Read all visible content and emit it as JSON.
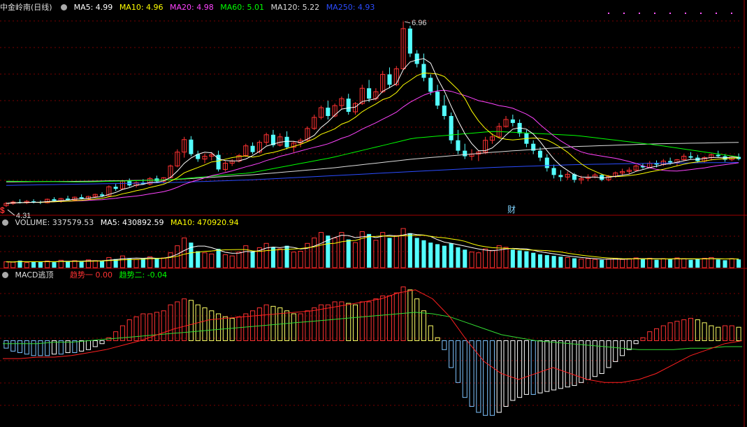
{
  "header": {
    "stock_name": "中金岭南(日线)",
    "ma": [
      {
        "label": "MA5: 4.99",
        "color": "#ffffff"
      },
      {
        "label": "MA10: 4.96",
        "color": "#ffff00"
      },
      {
        "label": "MA20: 4.98",
        "color": "#ff44ff"
      },
      {
        "label": "MA60: 5.01",
        "color": "#00ff00"
      },
      {
        "label": "MA120: 5.22",
        "color": "#dddddd"
      },
      {
        "label": "MA250: 4.93",
        "color": "#2b4cff"
      }
    ]
  },
  "annotations": {
    "high": "6.96",
    "low": "4.31",
    "marker": "财",
    "left_marker": "$"
  },
  "volume_legend": {
    "name": "VOLUME: 337579.53",
    "ma5": "MA5: 430892.59",
    "ma10": "MA10: 470920.94"
  },
  "macd_legend": {
    "name": "MACD逃顶",
    "trend1": "趋势一 0.00",
    "trend2": "趋势二: -0.04"
  },
  "colors": {
    "up": "#ff3232",
    "down": "#54ffff",
    "grid": "#7a0000",
    "ma5": "#ffffff",
    "ma10": "#ffff00",
    "ma20": "#ff44ff",
    "ma60": "#00ff00",
    "ma120": "#dddddd",
    "ma250": "#2b4cff"
  },
  "chart_data": [
    {
      "type": "candlestick",
      "price_range": [
        4.2,
        7.05
      ],
      "candles": [
        [
          4.31,
          4.36,
          4.29,
          4.34
        ],
        [
          4.34,
          4.38,
          4.32,
          4.36
        ],
        [
          4.36,
          4.4,
          4.34,
          4.35
        ],
        [
          4.35,
          4.39,
          4.33,
          4.37
        ],
        [
          4.37,
          4.4,
          4.34,
          4.36
        ],
        [
          4.36,
          4.38,
          4.33,
          4.35
        ],
        [
          4.35,
          4.41,
          4.34,
          4.4
        ],
        [
          4.4,
          4.43,
          4.37,
          4.38
        ],
        [
          4.38,
          4.42,
          4.35,
          4.41
        ],
        [
          4.41,
          4.45,
          4.38,
          4.39
        ],
        [
          4.39,
          4.44,
          4.37,
          4.43
        ],
        [
          4.43,
          4.47,
          4.4,
          4.41
        ],
        [
          4.41,
          4.45,
          4.39,
          4.44
        ],
        [
          4.44,
          4.48,
          4.42,
          4.47
        ],
        [
          4.47,
          4.5,
          4.43,
          4.45
        ],
        [
          4.45,
          4.6,
          4.44,
          4.58
        ],
        [
          4.58,
          4.62,
          4.52,
          4.55
        ],
        [
          4.55,
          4.68,
          4.54,
          4.66
        ],
        [
          4.66,
          4.7,
          4.58,
          4.6
        ],
        [
          4.6,
          4.66,
          4.57,
          4.64
        ],
        [
          4.64,
          4.69,
          4.61,
          4.62
        ],
        [
          4.62,
          4.72,
          4.6,
          4.7
        ],
        [
          4.7,
          4.74,
          4.64,
          4.66
        ],
        [
          4.66,
          4.72,
          4.63,
          4.71
        ],
        [
          4.71,
          4.9,
          4.7,
          4.88
        ],
        [
          4.88,
          5.12,
          4.86,
          5.08
        ],
        [
          5.08,
          5.3,
          5.0,
          5.26
        ],
        [
          5.26,
          5.31,
          5.02,
          5.05
        ],
        [
          5.05,
          5.1,
          4.94,
          4.98
        ],
        [
          4.98,
          5.06,
          4.92,
          5.02
        ],
        [
          5.02,
          5.08,
          4.96,
          5.04
        ],
        [
          5.04,
          5.1,
          4.8,
          4.83
        ],
        [
          4.83,
          4.95,
          4.8,
          4.92
        ],
        [
          4.92,
          4.98,
          4.88,
          4.95
        ],
        [
          4.95,
          5.05,
          4.93,
          5.03
        ],
        [
          5.03,
          5.2,
          5.01,
          5.17
        ],
        [
          5.17,
          5.22,
          5.05,
          5.08
        ],
        [
          5.08,
          5.25,
          5.06,
          5.22
        ],
        [
          5.22,
          5.36,
          5.18,
          5.33
        ],
        [
          5.33,
          5.4,
          5.15,
          5.18
        ],
        [
          5.18,
          5.35,
          5.16,
          5.3
        ],
        [
          5.3,
          5.38,
          5.12,
          5.15
        ],
        [
          5.15,
          5.24,
          5.08,
          5.21
        ],
        [
          5.21,
          5.28,
          5.15,
          5.25
        ],
        [
          5.25,
          5.45,
          5.23,
          5.42
        ],
        [
          5.42,
          5.62,
          5.4,
          5.58
        ],
        [
          5.58,
          5.75,
          5.55,
          5.72
        ],
        [
          5.72,
          5.82,
          5.55,
          5.6
        ],
        [
          5.6,
          5.78,
          5.58,
          5.75
        ],
        [
          5.75,
          5.88,
          5.7,
          5.85
        ],
        [
          5.85,
          5.92,
          5.62,
          5.66
        ],
        [
          5.66,
          5.8,
          5.62,
          5.78
        ],
        [
          5.78,
          6.05,
          5.76,
          6.0
        ],
        [
          6.0,
          6.12,
          5.8,
          5.85
        ],
        [
          5.85,
          6.0,
          5.82,
          5.95
        ],
        [
          5.95,
          6.25,
          5.93,
          6.2
        ],
        [
          6.2,
          6.3,
          6.0,
          6.05
        ],
        [
          6.05,
          6.32,
          6.03,
          6.28
        ],
        [
          6.28,
          6.96,
          6.26,
          6.86
        ],
        [
          6.86,
          6.9,
          6.45,
          6.5
        ],
        [
          6.5,
          6.55,
          6.3,
          6.35
        ],
        [
          6.35,
          6.5,
          6.1,
          6.15
        ],
        [
          6.15,
          6.2,
          5.9,
          5.95
        ],
        [
          5.95,
          6.05,
          5.7,
          5.75
        ],
        [
          5.75,
          5.9,
          5.55,
          5.6
        ],
        [
          5.6,
          5.65,
          5.2,
          5.25
        ],
        [
          5.25,
          5.4,
          5.05,
          5.1
        ],
        [
          5.1,
          5.2,
          4.98,
          5.02
        ],
        [
          5.02,
          5.12,
          4.96,
          5.05
        ],
        [
          5.05,
          5.1,
          4.95,
          5.08
        ],
        [
          5.08,
          5.3,
          5.05,
          5.25
        ],
        [
          5.25,
          5.35,
          5.2,
          5.3
        ],
        [
          5.3,
          5.5,
          5.28,
          5.45
        ],
        [
          5.45,
          5.6,
          5.43,
          5.55
        ],
        [
          5.55,
          5.62,
          5.45,
          5.5
        ],
        [
          5.5,
          5.55,
          5.3,
          5.35
        ],
        [
          5.35,
          5.4,
          5.15,
          5.2
        ],
        [
          5.2,
          5.25,
          5.05,
          5.1
        ],
        [
          5.1,
          5.15,
          4.95,
          5.0
        ],
        [
          5.0,
          5.05,
          4.8,
          4.85
        ],
        [
          4.85,
          4.9,
          4.7,
          4.75
        ],
        [
          4.75,
          4.82,
          4.66,
          4.72
        ],
        [
          4.72,
          4.8,
          4.68,
          4.76
        ],
        [
          4.76,
          4.78,
          4.64,
          4.68
        ],
        [
          4.68,
          4.74,
          4.62,
          4.7
        ],
        [
          4.7,
          4.76,
          4.66,
          4.72
        ],
        [
          4.72,
          4.78,
          4.7,
          4.75
        ],
        [
          4.75,
          4.77,
          4.66,
          4.68
        ],
        [
          4.68,
          4.75,
          4.66,
          4.73
        ],
        [
          4.73,
          4.8,
          4.71,
          4.78
        ],
        [
          4.78,
          4.84,
          4.74,
          4.8
        ],
        [
          4.8,
          4.86,
          4.76,
          4.82
        ],
        [
          4.82,
          4.9,
          4.8,
          4.88
        ],
        [
          4.88,
          4.92,
          4.84,
          4.86
        ],
        [
          4.86,
          4.95,
          4.85,
          4.92
        ],
        [
          4.92,
          4.96,
          4.86,
          4.9
        ],
        [
          4.9,
          4.98,
          4.88,
          4.95
        ],
        [
          4.95,
          5.0,
          4.9,
          4.93
        ],
        [
          4.93,
          4.98,
          4.88,
          4.97
        ],
        [
          4.97,
          5.05,
          4.95,
          5.02
        ],
        [
          5.02,
          5.08,
          4.98,
          5.0
        ],
        [
          5.0,
          5.04,
          4.92,
          4.95
        ],
        [
          4.95,
          5.02,
          4.93,
          5.0
        ],
        [
          5.0,
          5.06,
          4.96,
          5.04
        ],
        [
          5.04,
          5.1,
          5.0,
          5.02
        ],
        [
          5.02,
          5.05,
          4.94,
          4.97
        ],
        [
          4.97,
          5.03,
          4.95,
          5.01
        ],
        [
          5.01,
          5.06,
          4.96,
          4.98
        ]
      ],
      "ma_series": [
        "MA5",
        "MA10",
        "MA20",
        "MA60",
        "MA120",
        "MA250"
      ],
      "ma250_values": [
        4.6,
        4.62,
        4.64,
        4.68,
        4.74,
        4.8,
        4.86,
        4.9,
        4.92,
        4.93
      ],
      "ma120_values": [
        4.65,
        4.66,
        4.68,
        4.75,
        4.85,
        4.98,
        5.08,
        5.16,
        5.2,
        5.22
      ],
      "ma60_values": [
        4.66,
        4.65,
        4.68,
        4.78,
        5.0,
        5.28,
        5.38,
        5.32,
        5.18,
        5.01
      ]
    },
    {
      "type": "bar",
      "title": "VOLUME",
      "volume_max": 1000000,
      "values": [
        150000,
        140000,
        180000,
        130000,
        160000,
        150000,
        170000,
        140000,
        190000,
        160000,
        180000,
        150000,
        200000,
        180000,
        170000,
        260000,
        220000,
        300000,
        240000,
        210000,
        230000,
        280000,
        240000,
        250000,
        380000,
        560000,
        760000,
        640000,
        420000,
        380000,
        350000,
        480000,
        330000,
        300000,
        400000,
        560000,
        420000,
        510000,
        620000,
        520000,
        480000,
        560000,
        400000,
        420000,
        620000,
        760000,
        900000,
        820000,
        760000,
        900000,
        720000,
        640000,
        920000,
        860000,
        700000,
        900000,
        760000,
        820000,
        1000000,
        880000,
        760000,
        700000,
        640000,
        600000,
        560000,
        620000,
        520000,
        460000,
        400000,
        380000,
        480000,
        440000,
        560000,
        520000,
        460000,
        440000,
        420000,
        380000,
        340000,
        320000,
        300000,
        280000,
        260000,
        240000,
        220000,
        230000,
        210000,
        200000,
        220000,
        240000,
        210000,
        230000,
        250000,
        220000,
        240000,
        200000,
        230000,
        210000,
        250000,
        230000,
        200000,
        220000,
        240000,
        260000,
        210000,
        190000,
        230000,
        210000
      ]
    },
    {
      "type": "bar",
      "title": "MACD逃顶",
      "macd_range": [
        -0.55,
        0.4
      ],
      "values": [
        -0.05,
        -0.07,
        -0.08,
        -0.09,
        -0.1,
        -0.1,
        -0.1,
        -0.09,
        -0.09,
        -0.08,
        -0.08,
        -0.07,
        -0.06,
        -0.04,
        -0.02,
        0.02,
        0.06,
        0.1,
        0.14,
        0.16,
        0.18,
        0.18,
        0.19,
        0.2,
        0.24,
        0.26,
        0.28,
        0.27,
        0.24,
        0.22,
        0.2,
        0.18,
        0.16,
        0.15,
        0.16,
        0.18,
        0.2,
        0.22,
        0.24,
        0.23,
        0.22,
        0.2,
        0.18,
        0.18,
        0.2,
        0.22,
        0.24,
        0.24,
        0.26,
        0.26,
        0.25,
        0.24,
        0.26,
        0.26,
        0.28,
        0.3,
        0.3,
        0.32,
        0.36,
        0.34,
        0.28,
        0.2,
        0.1,
        0.02,
        -0.06,
        -0.18,
        -0.28,
        -0.38,
        -0.44,
        -0.48,
        -0.5,
        -0.5,
        -0.48,
        -0.44,
        -0.4,
        -0.38,
        -0.36,
        -0.36,
        -0.35,
        -0.34,
        -0.33,
        -0.32,
        -0.31,
        -0.3,
        -0.28,
        -0.26,
        -0.24,
        -0.22,
        -0.18,
        -0.14,
        -0.1,
        -0.06,
        -0.02,
        0.02,
        0.06,
        0.08,
        0.1,
        0.12,
        0.13,
        0.14,
        0.15,
        0.14,
        0.12,
        0.1,
        0.09,
        0.1,
        0.1,
        0.09
      ],
      "trend1": [
        -0.12,
        -0.12,
        -0.11,
        -0.11,
        -0.1,
        -0.08,
        -0.06,
        -0.03,
        0.0,
        0.04,
        0.08,
        0.11,
        0.14,
        0.15,
        0.16,
        0.17,
        0.18,
        0.19,
        0.2,
        0.22,
        0.24,
        0.26,
        0.28,
        0.32,
        0.34,
        0.28,
        0.16,
        0.0,
        -0.14,
        -0.22,
        -0.26,
        -0.22,
        -0.18,
        -0.22,
        -0.26,
        -0.28,
        -0.28,
        -0.26,
        -0.22,
        -0.16,
        -0.1,
        -0.06,
        -0.02,
        0.0
      ],
      "trend2": [
        -0.02,
        -0.02,
        -0.02,
        -0.01,
        -0.01,
        0.0,
        0.01,
        0.02,
        0.03,
        0.04,
        0.05,
        0.06,
        0.07,
        0.08,
        0.09,
        0.1,
        0.11,
        0.12,
        0.13,
        0.14,
        0.15,
        0.16,
        0.17,
        0.18,
        0.19,
        0.18,
        0.16,
        0.12,
        0.08,
        0.04,
        0.02,
        0.0,
        -0.01,
        -0.02,
        -0.03,
        -0.04,
        -0.05,
        -0.06,
        -0.06,
        -0.06,
        -0.05,
        -0.05,
        -0.04,
        -0.04
      ]
    }
  ]
}
